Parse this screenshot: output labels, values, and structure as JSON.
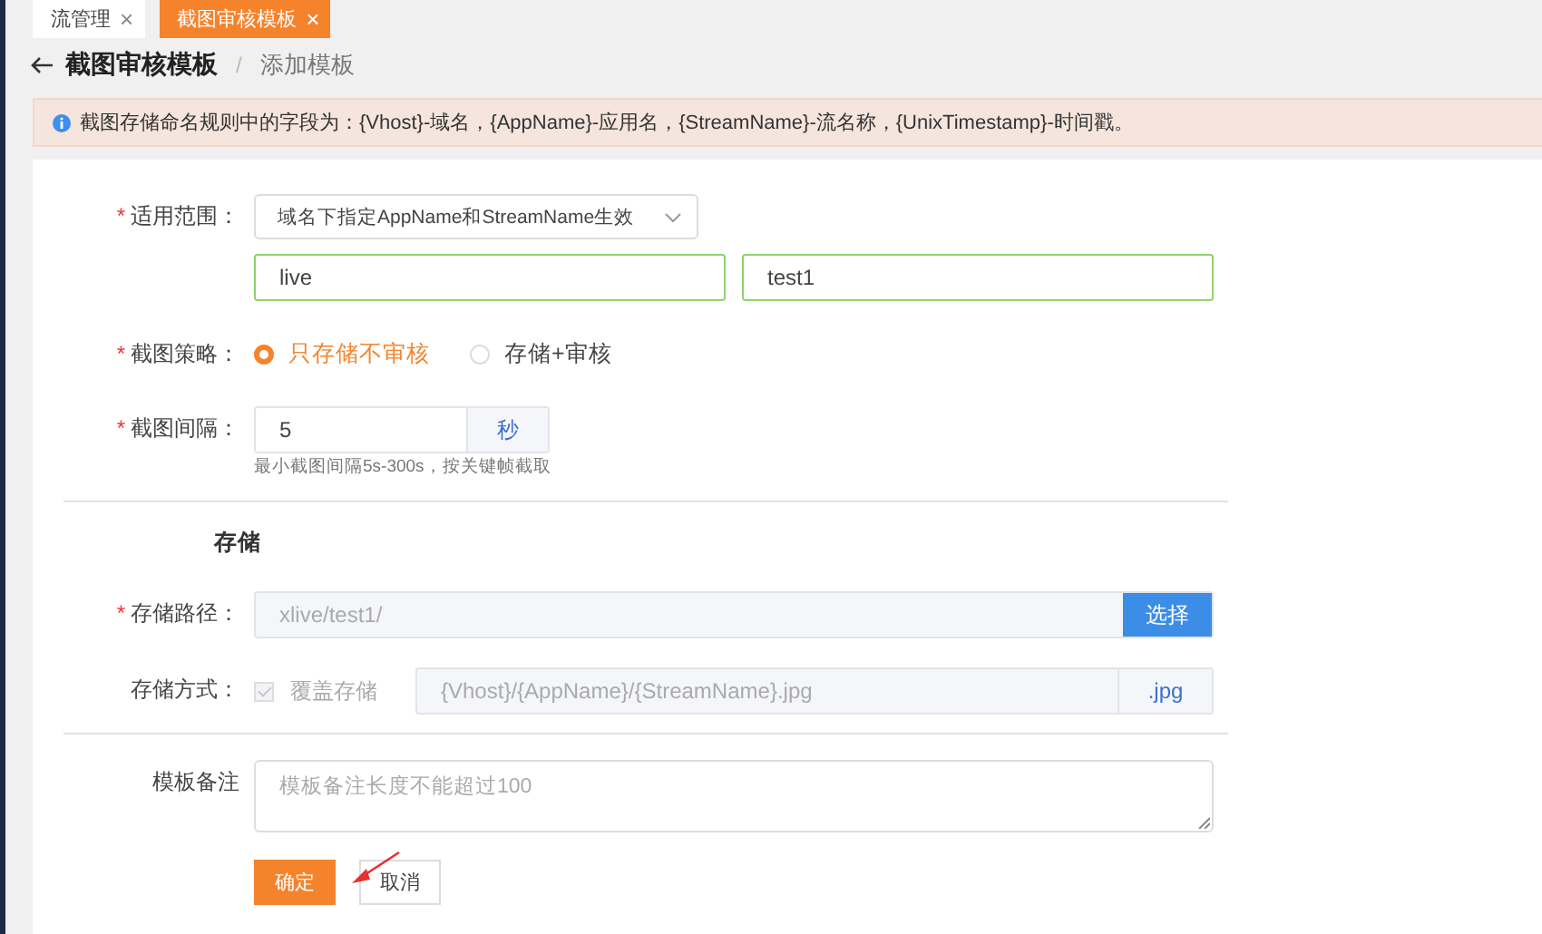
{
  "tabs": [
    {
      "label": "流管理",
      "close": "×",
      "selected": false
    },
    {
      "label": "截图审核模板",
      "close": "×",
      "selected": true
    }
  ],
  "breadcrumb": {
    "title": "截图审核模板",
    "separator": "/",
    "current": "添加模板"
  },
  "alert": {
    "text": "截图存储命名规则中的字段为：{Vhost}-域名，{AppName}-应用名，{StreamName}-流名称，{UnixTimestamp}-时间戳。"
  },
  "form": {
    "rows": [
      {
        "kind": "select",
        "required_mark": "*",
        "label": "适用范围：",
        "value": "域名下指定AppName和StreamName生效",
        "inputs": [
          {
            "value": "live"
          },
          {
            "value": "test1"
          }
        ]
      },
      {
        "kind": "radio",
        "required_mark": "*",
        "label": "截图策略：",
        "options": [
          {
            "label": "只存储不审核",
            "selected": true
          },
          {
            "label": "存储+审核",
            "selected": false
          }
        ]
      },
      {
        "kind": "number",
        "required_mark": "*",
        "label": "截图间隔：",
        "value": "5",
        "unit": "秒",
        "hint": "最小截图间隔5s-300s，按关键帧截取"
      },
      {
        "kind": "divider"
      },
      {
        "kind": "heading",
        "label": "存储"
      },
      {
        "kind": "path",
        "required_mark": "*",
        "label": "存储路径：",
        "value": "xlive/test1/",
        "button": "选择"
      },
      {
        "kind": "mode",
        "label": "存储方式：",
        "checkbox": {
          "label": "覆盖存储",
          "checked": true,
          "disabled": true
        },
        "value": "{Vhost}/{AppName}/{StreamName}.jpg",
        "suffix": ".jpg"
      },
      {
        "kind": "divider"
      },
      {
        "kind": "textarea",
        "label": "模板备注",
        "placeholder": "模板备注长度不能超过100"
      },
      {
        "kind": "buttons",
        "buttons": [
          {
            "label": "确定",
            "kind": "primary"
          },
          {
            "label": "取消",
            "kind": "default"
          }
        ]
      }
    ]
  }
}
